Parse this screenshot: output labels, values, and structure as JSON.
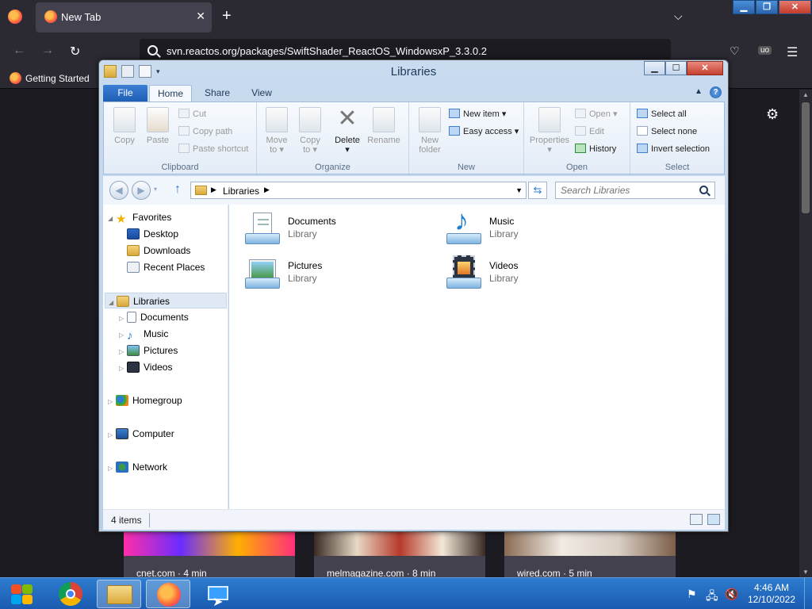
{
  "firefox": {
    "tab_title": "New Tab",
    "tab_close": "✕",
    "new_tab": "+",
    "url": "svn.reactos.org/packages/SwiftShader_ReactOS_WindowsxP_3.3.0.2",
    "bookmark": "Getting Started",
    "tiles": [
      {
        "caption": "cnet.com · 4 min"
      },
      {
        "caption": "melmagazine.com · 8 min"
      },
      {
        "caption": "wired.com · 5 min"
      }
    ]
  },
  "explorer": {
    "title": "Libraries",
    "tabs": {
      "file": "File",
      "home": "Home",
      "share": "Share",
      "view": "View"
    },
    "ribbon": {
      "clipboard": {
        "label": "Clipboard",
        "copy": "Copy",
        "paste": "Paste",
        "cut": "Cut",
        "copy_path": "Copy path",
        "paste_shortcut": "Paste shortcut"
      },
      "organize": {
        "label": "Organize",
        "move_to_1": "Move",
        "move_to_2": "to",
        "copy_to_1": "Copy",
        "copy_to_2": "to",
        "delete": "Delete",
        "rename": "Rename"
      },
      "new": {
        "label": "New",
        "new_folder_1": "New",
        "new_folder_2": "folder",
        "new_item": "New item",
        "easy_access": "Easy access"
      },
      "open": {
        "label": "Open",
        "properties": "Properties",
        "open": "Open",
        "edit": "Edit",
        "history": "History"
      },
      "select": {
        "label": "Select",
        "select_all": "Select all",
        "select_none": "Select none",
        "invert": "Invert selection"
      }
    },
    "address": {
      "crumb": "Libraries",
      "search_placeholder": "Search Libraries"
    },
    "nav": {
      "favorites": "Favorites",
      "desktop": "Desktop",
      "downloads": "Downloads",
      "recent": "Recent Places",
      "libraries": "Libraries",
      "documents": "Documents",
      "music": "Music",
      "pictures": "Pictures",
      "videos": "Videos",
      "homegroup": "Homegroup",
      "computer": "Computer",
      "network": "Network"
    },
    "libraries": [
      {
        "name": "Documents",
        "type": "Library"
      },
      {
        "name": "Music",
        "type": "Library"
      },
      {
        "name": "Pictures",
        "type": "Library"
      },
      {
        "name": "Videos",
        "type": "Library"
      }
    ],
    "status": {
      "count": "4 items"
    }
  },
  "taskbar": {
    "time": "4:46 AM",
    "date": "12/10/2022"
  },
  "colors": {
    "firefox_chrome": "#2b2a33",
    "taskbar": "#1f62b8",
    "ribbon_file": "#2a6ec8"
  }
}
